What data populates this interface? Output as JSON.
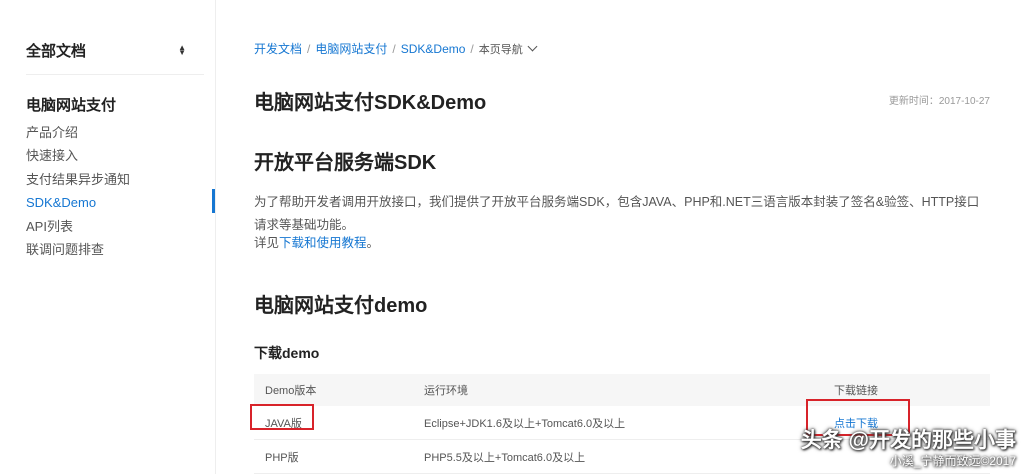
{
  "sidebar": {
    "all_docs": "全部文档",
    "section_title": "电脑网站支付",
    "items": [
      {
        "label": "产品介绍"
      },
      {
        "label": "快速接入"
      },
      {
        "label": "支付结果异步通知"
      },
      {
        "label": "SDK&Demo"
      },
      {
        "label": "API列表"
      },
      {
        "label": "联调问题排查"
      }
    ]
  },
  "breadcrumb": {
    "items": [
      "开发文档",
      "电脑网站支付",
      "SDK&Demo"
    ],
    "page_nav": "本页导航"
  },
  "page": {
    "title": "电脑网站支付SDK&Demo",
    "update_time": "更新时间：2017-10-27",
    "sdk_heading": "开放平台服务端SDK",
    "sdk_desc": "为了帮助开发者调用开放接口，我们提供了开放平台服务端SDK，包含JAVA、PHP和.NET三语言版本封装了签名&验签、HTTP接口请求等基础功能。",
    "see_prefix": "详见",
    "see_link": "下载和使用教程",
    "see_suffix": "。",
    "demo_heading": "电脑网站支付demo",
    "download_heading": "下载demo"
  },
  "table": {
    "headers": [
      "Demo版本",
      "运行环境",
      "下载链接"
    ],
    "rows": [
      {
        "version": "JAVA版",
        "env": "Eclipse+JDK1.6及以上+Tomcat6.0及以上",
        "link": "点击下载"
      },
      {
        "version": "PHP版",
        "env": "PHP5.5及以上+Tomcat6.0及以上",
        "link": ""
      }
    ]
  },
  "watermark": {
    "main": "头条 @开发的那些小事",
    "sub": "小溪_宁静而致远©2017"
  },
  "colors": {
    "accent": "#1677d2",
    "highlight_box": "#d8232a"
  }
}
